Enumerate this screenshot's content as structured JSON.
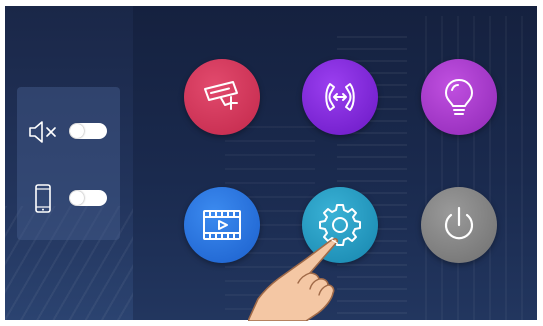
{
  "colors": {
    "camera": "#d1355a",
    "transfer": "#7d26d8",
    "light": "#a93bcc",
    "video": "#2a73df",
    "settings": "#2199c1",
    "power": "#848484",
    "panel": "#465f91"
  },
  "icons": {
    "mute": "speaker-mute-icon",
    "phone": "phone-icon",
    "camera": "security-camera-icon",
    "transfer": "call-transfer-icon",
    "light": "light-bulb-icon",
    "video": "video-playback-icon",
    "settings": "gear-icon",
    "power": "power-icon"
  },
  "toggles": {
    "mute": {
      "on": false
    },
    "phone": {
      "on": false
    }
  }
}
